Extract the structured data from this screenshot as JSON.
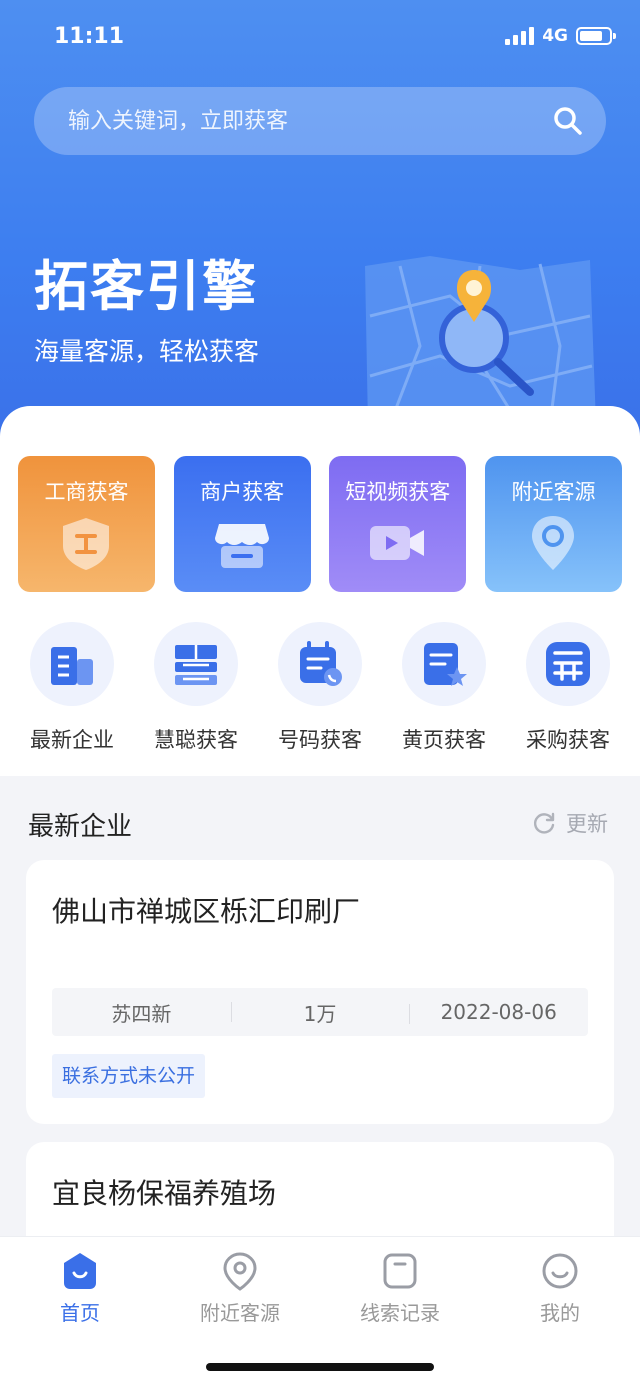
{
  "status_bar": {
    "time": "11:11",
    "network": "4G"
  },
  "search": {
    "placeholder": "输入关键词，立即获客"
  },
  "hero": {
    "title": "拓客引擎",
    "subtitle": "海量客源，轻松获客"
  },
  "feature_cards": [
    {
      "label": "工商获客",
      "icon": "business-badge-icon",
      "color": "#f0933c"
    },
    {
      "label": "商户获客",
      "icon": "storefront-icon",
      "color": "#3b6ff0"
    },
    {
      "label": "短视频获客",
      "icon": "video-camera-icon",
      "color": "#7e6cf2"
    },
    {
      "label": "附近客源",
      "icon": "location-pin-icon",
      "color": "#4f94ef"
    }
  ],
  "quick_grid": [
    {
      "label": "最新企业",
      "icon": "building-icon"
    },
    {
      "label": "慧聪获客",
      "icon": "hui-character-icon"
    },
    {
      "label": "号码获客",
      "icon": "phone-list-icon"
    },
    {
      "label": "黄页获客",
      "icon": "yellow-pages-star-icon"
    },
    {
      "label": "采购获客",
      "icon": "purchase-grid-icon"
    }
  ],
  "latest_section": {
    "title": "最新企业",
    "refresh_label": "更新"
  },
  "enterprises": [
    {
      "name": "佛山市禅城区栎汇印刷厂",
      "owner": "苏四新",
      "capital": "1万",
      "date": "2022-08-06",
      "tag": "联系方式未公开"
    },
    {
      "name": "宜良杨保福养殖场"
    }
  ],
  "tab_bar": {
    "items": [
      {
        "label": "首页",
        "icon": "home-icon",
        "active": true
      },
      {
        "label": "附近客源",
        "icon": "location-icon",
        "active": false
      },
      {
        "label": "线索记录",
        "icon": "clue-record-icon",
        "active": false
      },
      {
        "label": "我的",
        "icon": "profile-smile-icon",
        "active": false
      }
    ]
  },
  "colors": {
    "accent": "#3a6fe8",
    "hero_bg": "#4e8ff1"
  }
}
